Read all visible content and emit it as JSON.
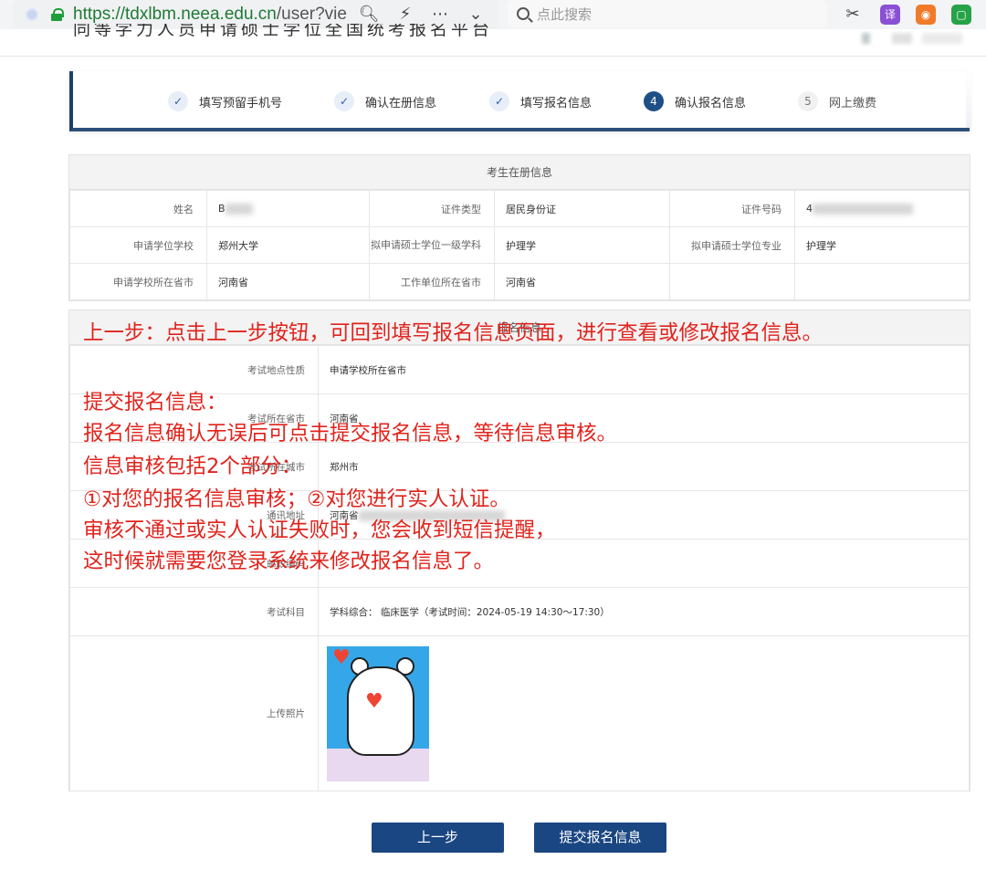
{
  "browser": {
    "url_host": "https://tdxlbm.neea.edu.cn",
    "url_path": "/user?vie",
    "search_placeholder": "点此搜索",
    "ext_translate": "译"
  },
  "site_title": "同等学力人员申请硕士学位全国统考报名平台",
  "steps": [
    {
      "num": "✓",
      "label": "填写预留手机号",
      "state": "done"
    },
    {
      "num": "✓",
      "label": "确认在册信息",
      "state": "done"
    },
    {
      "num": "✓",
      "label": "填写报名信息",
      "state": "done"
    },
    {
      "num": "4",
      "label": "确认报名信息",
      "state": "active"
    },
    {
      "num": "5",
      "label": "网上缴费",
      "state": "pending"
    }
  ],
  "registry": {
    "title": "考生在册信息",
    "rows": [
      [
        "姓名",
        "B",
        "证件类型",
        "居民身份证",
        "证件号码",
        "4"
      ],
      [
        "申请学位学校",
        "郑州大学",
        "拟申请硕士学位一级学科",
        "护理学",
        "拟申请硕士学位专业",
        "护理学"
      ],
      [
        "申请学校所在省市",
        "河南省",
        "工作单位所在省市",
        "河南省",
        "",
        ""
      ]
    ]
  },
  "exam": {
    "title": "报名信息",
    "rows": [
      {
        "label": "考试地点性质",
        "value": "申请学校所在省市"
      },
      {
        "label": "考试所在省市",
        "value": "河南省"
      },
      {
        "label": "考试所在城市",
        "value": "郑州市"
      },
      {
        "label": "通讯地址",
        "value": "河南省"
      },
      {
        "label": "邮政编码",
        "value": ""
      },
      {
        "label": "考试科目",
        "value": "学科综合：    临床医学（考试时间：2024-05-19 14:30～17:30）"
      },
      {
        "label": "上传照片",
        "value": ""
      }
    ]
  },
  "annotations": {
    "line1": "上一步：点击上一步按钮，可回到填写报名信息页面，进行查看或修改报名信息。",
    "line2": "提交报名信息：",
    "line3": "报名信息确认无误后可点击提交报名信息，等待信息审核。",
    "line4": "信息审核包括2个部分：",
    "line5": "①对您的报名信息审核；②对您进行实人认证。",
    "line6": "审核不通过或实人认证失败时，您会收到短信提醒，",
    "line7": "这时候就需要您登录系统来修改报名信息了。"
  },
  "buttons": {
    "prev": "上一步",
    "submit": "提交报名信息"
  },
  "colors": {
    "primary": "#1a4682",
    "annotation": "#e0231c",
    "url_green": "#1f7a35"
  }
}
